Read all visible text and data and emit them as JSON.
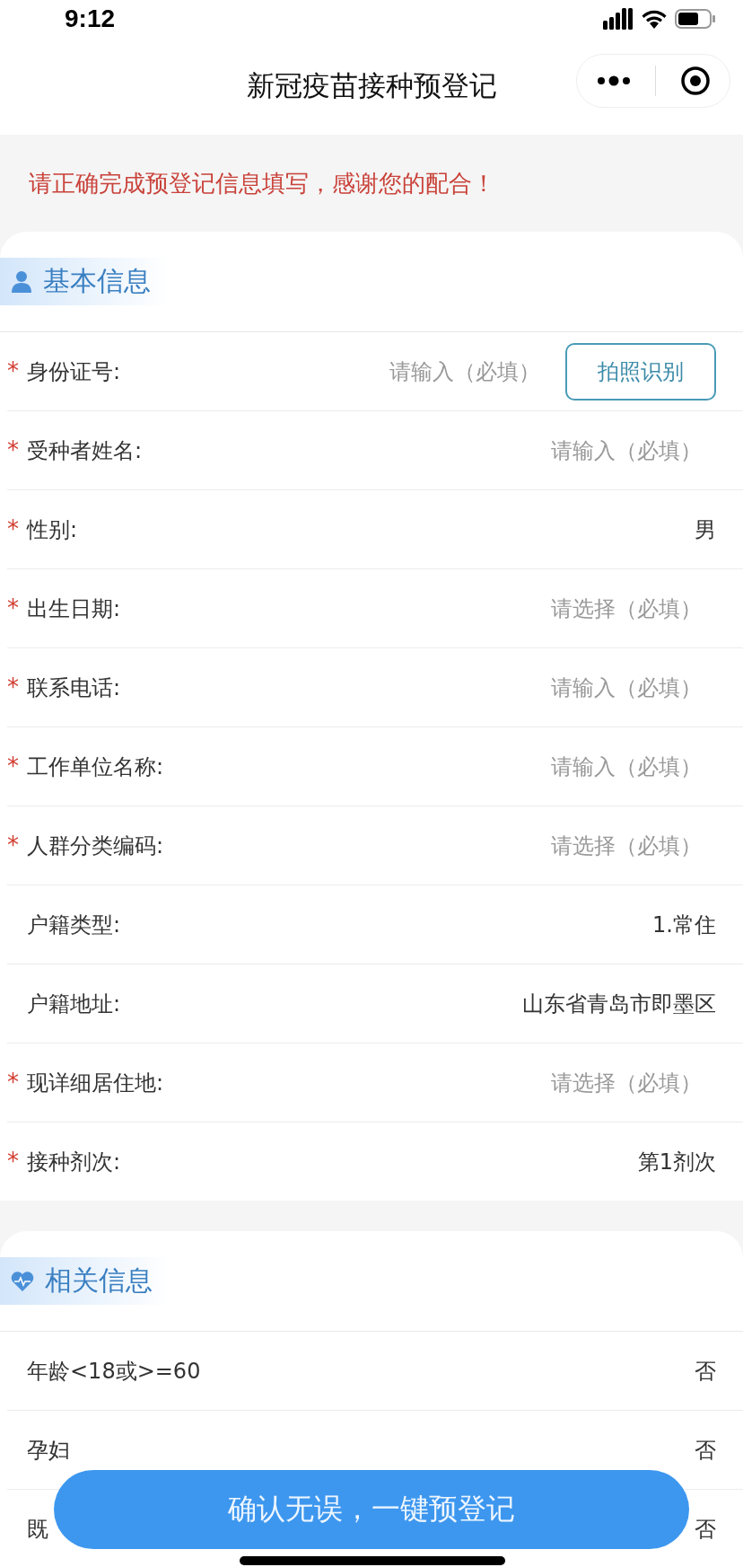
{
  "status_bar": {
    "time": "9:12"
  },
  "nav": {
    "title": "新冠疫苗接种预登记"
  },
  "notice": "请正确完成预登记信息填写，感谢您的配合！",
  "sections": [
    {
      "title": "基本信息",
      "kind": "person",
      "rows": [
        {
          "label": "身份证号:",
          "required": true,
          "placeholder": "请输入（必填）",
          "action": "拍照识别"
        },
        {
          "label": "受种者姓名:",
          "required": true,
          "placeholder": "请输入（必填）"
        },
        {
          "label": "性别:",
          "required": true,
          "value": "男"
        },
        {
          "label": "出生日期:",
          "required": true,
          "placeholder": "请选择（必填）"
        },
        {
          "label": "联系电话:",
          "required": true,
          "placeholder": "请输入（必填）"
        },
        {
          "label": "工作单位名称:",
          "required": true,
          "placeholder": "请输入（必填）"
        },
        {
          "label": "人群分类编码:",
          "required": true,
          "placeholder": "请选择（必填）"
        },
        {
          "label": "户籍类型:",
          "required": false,
          "value": "1.常住"
        },
        {
          "label": "户籍地址:",
          "required": false,
          "value": "山东省青岛市即墨区"
        },
        {
          "label": "现详细居住地:",
          "required": true,
          "placeholder": "请选择（必填）"
        },
        {
          "label": "接种剂次:",
          "required": true,
          "value": "第1剂次"
        }
      ]
    },
    {
      "title": "相关信息",
      "kind": "heart",
      "rows": [
        {
          "label": "年龄<18或>=60",
          "required": false,
          "value": "否"
        },
        {
          "label": "孕妇",
          "required": false,
          "value": "否"
        },
        {
          "label": "既",
          "required": false,
          "value": "否"
        }
      ]
    }
  ],
  "required_mark": "*",
  "submit_button": "确认无误，一键预登记"
}
